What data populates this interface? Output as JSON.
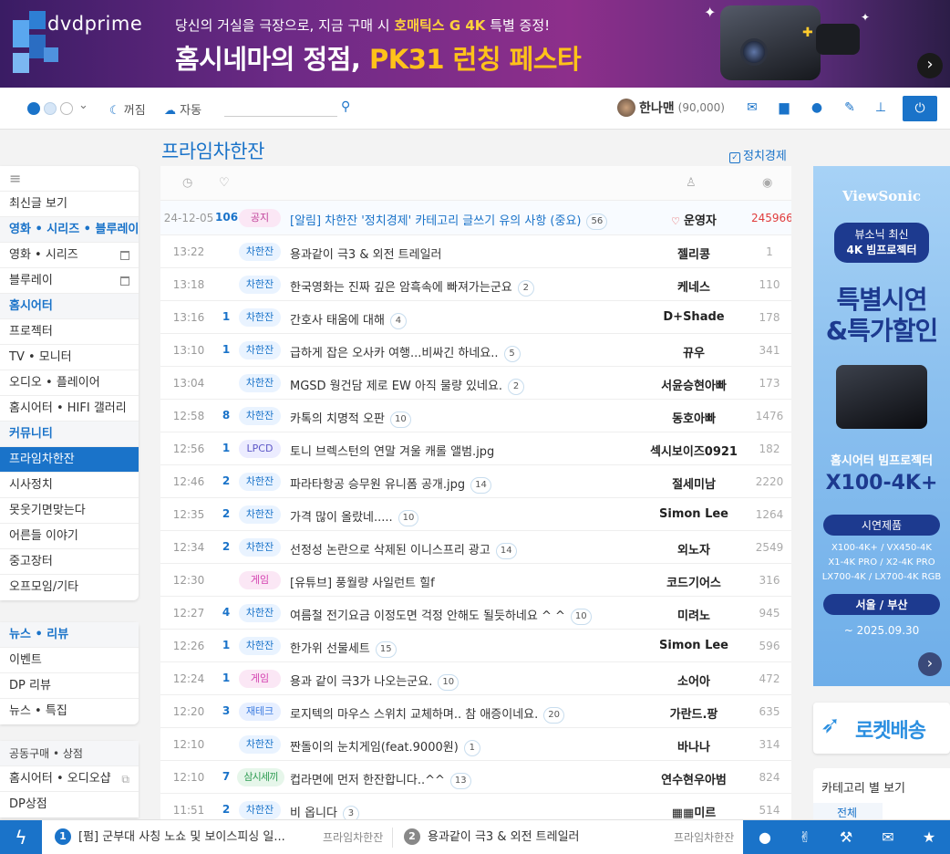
{
  "banner": {
    "logo": "dvdprime",
    "sub_pre": "당신의 거실을 극장으로, 지금 구매 시 ",
    "sub_hl": "호매틱스 G 4K",
    "sub_post": " 특별 증정!",
    "main_pre": "홈시네마의 정점, ",
    "main_hl": "PK31 런칭 페스타",
    "next": "›"
  },
  "toolbar": {
    "dark": "꺼짐",
    "weather": "자동",
    "search_placeholder": "",
    "user_name": "한나맨",
    "user_points": "(90,000)"
  },
  "page": {
    "title": "프라임차한잔",
    "politics": "정치경제"
  },
  "sidebar1": {
    "menu": "≡",
    "items": [
      "최신글 보기",
      "영화 • 시리즈 • 블루레이",
      "영화 • 시리즈",
      "블루레이",
      "홈시어터",
      "프로젝터",
      "TV • 모니터",
      "오디오 • 플레이어",
      "홈시어터 • HIFI 갤러리",
      "커뮤니티",
      "프라임차한잔",
      "시사정치",
      "못웃기면맞는다",
      "어른들 이야기",
      "중고장터",
      "오프모임/기타"
    ]
  },
  "sidebar2": {
    "items": [
      "뉴스 • 리뷰",
      "이벤트",
      "DP 리뷰",
      "뉴스 • 특집"
    ]
  },
  "sidebar3": {
    "items": [
      "공동구매 • 상점",
      "홈시어터 • 오디오샵",
      "DP상점"
    ]
  },
  "posts": [
    {
      "time": "24-12-05",
      "rec": "106",
      "cat": "공지",
      "title": "[알림] 차한잔 '정치경제' 카테고리 글쓰기 유의 사항 (중요)",
      "comments": "56",
      "author": "운영자",
      "views": "245966"
    },
    {
      "time": "13:22",
      "rec": "",
      "cat": "차한잔",
      "title": "용과같이 극3 & 외전 트레일러",
      "comments": "",
      "author": "젤리콩",
      "views": "1"
    },
    {
      "time": "13:18",
      "rec": "",
      "cat": "차한잔",
      "title": "한국영화는 진짜 깊은 암흑속에 빠져가는군요",
      "comments": "2",
      "author": "케네스",
      "views": "110"
    },
    {
      "time": "13:16",
      "rec": "1",
      "cat": "차한잔",
      "title": "간호사 태움에 대해",
      "comments": "4",
      "author": "D+Shade",
      "views": "178"
    },
    {
      "time": "13:10",
      "rec": "1",
      "cat": "차한잔",
      "title": "급하게 잡은 오사카 여행...비싸긴 하네요..",
      "comments": "5",
      "author": "뀨우",
      "views": "341"
    },
    {
      "time": "13:04",
      "rec": "",
      "cat": "차한잔",
      "title": "MGSD 웡건담 제로 EW 아직 물량 있네요.",
      "comments": "2",
      "author": "서윤승현아빠",
      "views": "173"
    },
    {
      "time": "12:58",
      "rec": "8",
      "cat": "차한잔",
      "title": "카톡의 치명적 오판",
      "comments": "10",
      "author": "동호아빠",
      "views": "1476"
    },
    {
      "time": "12:56",
      "rec": "1",
      "cat": "LPCD",
      "title": "토니 브렉스턴의 연말 겨울 캐롤 앨범.jpg",
      "comments": "",
      "author": "섹시보이즈0921",
      "views": "182"
    },
    {
      "time": "12:46",
      "rec": "2",
      "cat": "차한잔",
      "title": "파라타항공 승무원 유니폼 공개.jpg",
      "comments": "14",
      "author": "절세미남",
      "views": "2220"
    },
    {
      "time": "12:35",
      "rec": "2",
      "cat": "차한잔",
      "title": "가격 많이 올랐네.....",
      "comments": "10",
      "author": "Simon Lee",
      "views": "1264"
    },
    {
      "time": "12:34",
      "rec": "2",
      "cat": "차한잔",
      "title": "선정성 논란으로 삭제된 이니스프리 광고",
      "comments": "14",
      "author": "외노자",
      "views": "2549"
    },
    {
      "time": "12:30",
      "rec": "",
      "cat": "게임",
      "title": "[유튜브] 풍월량 사일런트 힐f",
      "comments": "",
      "author": "코드기어스",
      "views": "316"
    },
    {
      "time": "12:27",
      "rec": "4",
      "cat": "차한잔",
      "title": "여름철 전기요금 이정도면 걱정 안해도 될듯하네요 ^ ^",
      "comments": "10",
      "author": "미려노",
      "views": "945"
    },
    {
      "time": "12:26",
      "rec": "1",
      "cat": "차한잔",
      "title": "한가위 선물세트",
      "comments": "15",
      "author": "Simon Lee",
      "views": "596"
    },
    {
      "time": "12:24",
      "rec": "1",
      "cat": "게임",
      "title": "용과 같이 극3가 나오는군요.",
      "comments": "10",
      "author": "소어아",
      "views": "472"
    },
    {
      "time": "12:20",
      "rec": "3",
      "cat": "재테크",
      "title": "로지텍의 마우스 스위치 교체하며.. 참 애증이네요.",
      "comments": "20",
      "author": "가란드.팡",
      "views": "635"
    },
    {
      "time": "12:10",
      "rec": "",
      "cat": "차한잔",
      "title": "짠돌이의 눈치게임(feat.9000원)",
      "comments": "1",
      "author": "바나나",
      "views": "314"
    },
    {
      "time": "12:10",
      "rec": "7",
      "cat": "삼시세끼",
      "title": "컵라면에 먼저 한잔합니다..^^",
      "comments": "13",
      "author": "연수현우아범",
      "views": "824"
    },
    {
      "time": "11:51",
      "rec": "2",
      "cat": "차한잔",
      "title": "비 옵니다",
      "comments": "3",
      "author": "▦▦미르",
      "views": "514"
    }
  ],
  "ad": {
    "brand": "ViewSonic",
    "pill1": "뷰소닉 최신",
    "pill2": "4K 빔프로젝터",
    "big1": "특별시연",
    "big2": "&특가할인",
    "sub1": "홈시어터 빔프로젝터",
    "sub2": "X100-4K+",
    "sample": "시연제품",
    "models1": "X100-4K+ / VX450-4K",
    "models2": "X1-4K PRO / X2-4K PRO",
    "models3": "LX700-4K / LX700-4K RGB",
    "region": "서울 / 부산",
    "date": "~ 2025.09.30",
    "next": "›"
  },
  "rocket": {
    "text": "로켓배송"
  },
  "category": {
    "title": "카테고리 별 보기",
    "all": "전체"
  },
  "bottom": {
    "n1": "1",
    "t1": "[펌] 군부대 사칭 노쇼 및 보이스피싱 일...",
    "b1": "프라임차한잔",
    "n2": "2",
    "t2": "용과같이 극3 & 외전 트레일러",
    "b2": "프라임차한잔"
  },
  "colors": {
    "accent": "#1a73c9",
    "notice_views": "#e03b3b"
  }
}
